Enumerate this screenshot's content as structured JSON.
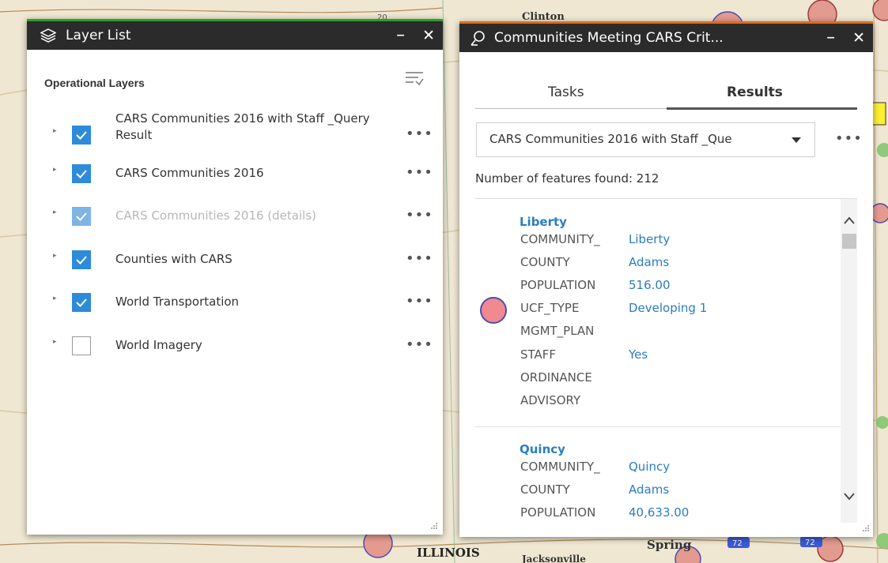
{
  "map": {
    "labels": {
      "top": "Clinton",
      "illinois": "ILLINOIS",
      "spring": "Spring",
      "jackson": "Jacksonville",
      "route_a": "72",
      "route_b": "72",
      "route_c": "20"
    }
  },
  "layer_list": {
    "title": "Layer List",
    "minimize": "–",
    "close": "✕",
    "section": "Operational Layers",
    "layers": [
      {
        "label": "CARS Communities 2016 with Staff _Query Result",
        "checked": true,
        "dim": false
      },
      {
        "label": "CARS Communities 2016",
        "checked": true,
        "dim": false
      },
      {
        "label": "CARS Communities 2016 (details)",
        "checked": true,
        "dim": true
      },
      {
        "label": "Counties with CARS",
        "checked": true,
        "dim": false
      },
      {
        "label": "World Transportation",
        "checked": true,
        "dim": false
      },
      {
        "label": "World Imagery",
        "checked": false,
        "dim": false
      }
    ],
    "more": "•••"
  },
  "results_panel": {
    "title": "Communities Meeting CARS Crit...",
    "minimize": "–",
    "close": "✕",
    "tabs": [
      "Tasks",
      "Results"
    ],
    "active_tab": "Results",
    "selected_layer": "CARS Communities 2016 with Staff _Que",
    "more": "•••",
    "found_text": "Number of features found: 212",
    "features": [
      {
        "title": "Liberty",
        "fields": [
          {
            "name": "COMMUNITY_",
            "value": "Liberty"
          },
          {
            "name": "COUNTY",
            "value": "Adams"
          },
          {
            "name": "POPULATION",
            "value": "516.00"
          },
          {
            "name": "UCF_TYPE",
            "value": "Developing 1"
          },
          {
            "name": "MGMT_PLAN",
            "value": ""
          },
          {
            "name": "STAFF",
            "value": "Yes"
          },
          {
            "name": "ORDINANCE",
            "value": ""
          },
          {
            "name": "ADVISORY",
            "value": ""
          }
        ]
      },
      {
        "title": "Quincy",
        "fields": [
          {
            "name": "COMMUNITY_",
            "value": "Quincy"
          },
          {
            "name": "COUNTY",
            "value": "Adams"
          },
          {
            "name": "POPULATION",
            "value": "40,633.00"
          }
        ]
      }
    ]
  },
  "colors": {
    "titlebar": "#2b2b2b",
    "accent_green": "#2ca02c",
    "accent_orange": "#e46a1b",
    "link_blue": "#2a7dc2",
    "checkbox_blue": "#2d8bd9",
    "symbol_fill": "#f08a90",
    "symbol_stroke": "#4e4bb0"
  }
}
